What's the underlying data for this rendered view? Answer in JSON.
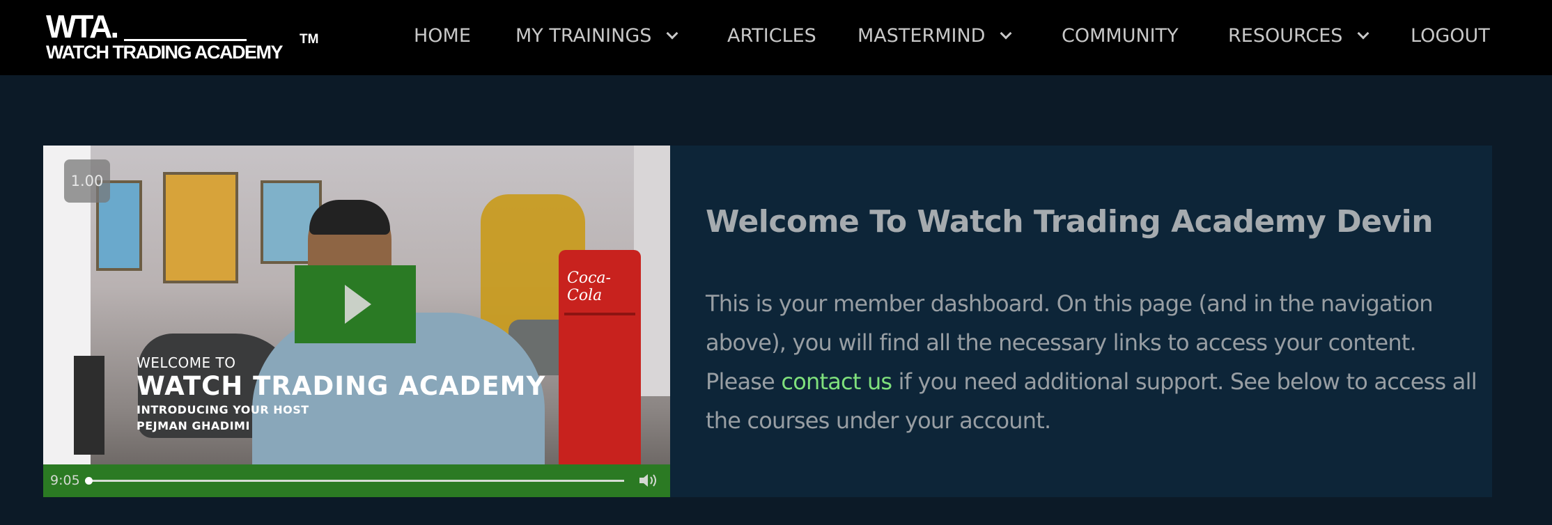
{
  "logo": {
    "mark": "WTA.",
    "name": "WATCH TRADING ACADEMY",
    "tm": "TM"
  },
  "nav": {
    "items": [
      {
        "label": "HOME",
        "dropdown": false
      },
      {
        "label": "MY TRAININGS",
        "dropdown": true
      },
      {
        "label": "ARTICLES",
        "dropdown": false
      },
      {
        "label": "MASTERMIND",
        "dropdown": true
      },
      {
        "label": "COMMUNITY",
        "dropdown": false
      },
      {
        "label": "RESOURCES",
        "dropdown": true
      },
      {
        "label": "LOGOUT",
        "dropdown": false
      }
    ]
  },
  "video": {
    "speed": "1.00",
    "lower_third": {
      "welcome_to": "WELCOME TO",
      "title": "WATCH TRADING ACADEMY",
      "line1": "INTRODUCING YOUR HOST",
      "line2": "PEJMAN GHADIMI"
    },
    "fridge_brand": "Coca-Cola",
    "duration": "9:05",
    "progress": 0,
    "play_icon": "play-icon",
    "volume_icon": "volume-icon"
  },
  "main": {
    "heading": "Welcome To Watch Trading Academy Devin",
    "desc_before": "This is your member dashboard. On this page (and in the navigation above), you will find all the necessary links to access your content. Please ",
    "desc_link": "contact us",
    "desc_after": " if you need additional support. See below to access all the courses under your account."
  },
  "colors": {
    "nav_bg": "#000000",
    "page_bg": "#0c1a27",
    "card_bg": "#0d2538",
    "accent_green": "#2b7a23",
    "link_green": "#7fe07c"
  }
}
